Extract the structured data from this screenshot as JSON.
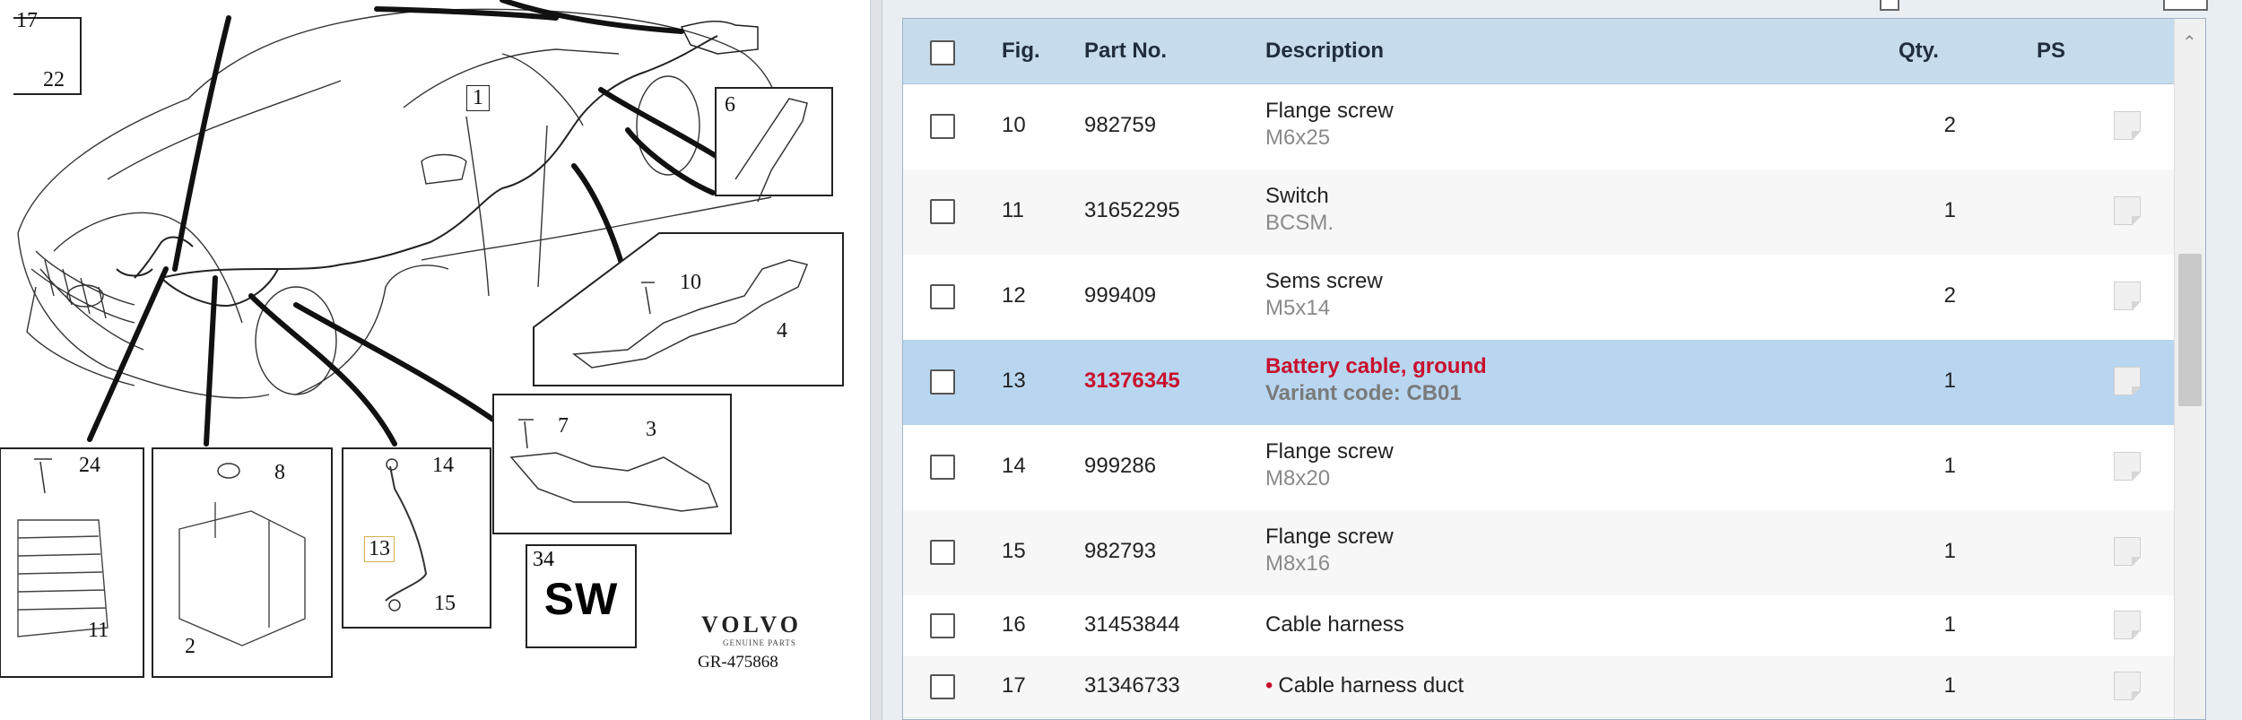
{
  "diagram": {
    "callouts": [
      "17",
      "22",
      "1",
      "6",
      "10",
      "4",
      "7",
      "3",
      "24",
      "8",
      "14",
      "13",
      "15",
      "11",
      "2"
    ],
    "sw_box": {
      "number": "34",
      "label": "SW"
    },
    "brand": "VOLVO",
    "brand_sub": "GENUINE PARTS",
    "reference": "GR-475868"
  },
  "table": {
    "headers": {
      "fig": "Fig.",
      "part_no": "Part No.",
      "description": "Description",
      "qty": "Qty.",
      "ps": "PS"
    },
    "rows": [
      {
        "fig": "10",
        "part_no": "982759",
        "desc": "Flange screw",
        "sub": "M6x25",
        "qty": "2"
      },
      {
        "fig": "11",
        "part_no": "31652295",
        "desc": "Switch",
        "sub": "BCSM.",
        "qty": "1"
      },
      {
        "fig": "12",
        "part_no": "999409",
        "desc": "Sems screw",
        "sub": "M5x14",
        "qty": "2"
      },
      {
        "fig": "13",
        "part_no": "31376345",
        "desc": "Battery cable, ground",
        "sub": "Variant code: CB01",
        "qty": "1",
        "selected": true
      },
      {
        "fig": "14",
        "part_no": "999286",
        "desc": "Flange screw",
        "sub": "M8x20",
        "qty": "1"
      },
      {
        "fig": "15",
        "part_no": "982793",
        "desc": "Flange screw",
        "sub": "M8x16",
        "qty": "1"
      },
      {
        "fig": "16",
        "part_no": "31453844",
        "desc": "Cable harness",
        "sub": "",
        "qty": "1"
      },
      {
        "fig": "17",
        "part_no": "31346733",
        "desc": "Cable harness duct",
        "sub": "",
        "qty": "1",
        "bullet": "•"
      }
    ]
  },
  "colors": {
    "header_bg": "#c6dbec",
    "selected_bg": "#b9d6f0",
    "selected_text": "#c8102e"
  },
  "icons": {
    "row_note": "note-icon",
    "scroll_up": "chevron-up-icon",
    "collapse": "collapse-arrow-icon"
  }
}
